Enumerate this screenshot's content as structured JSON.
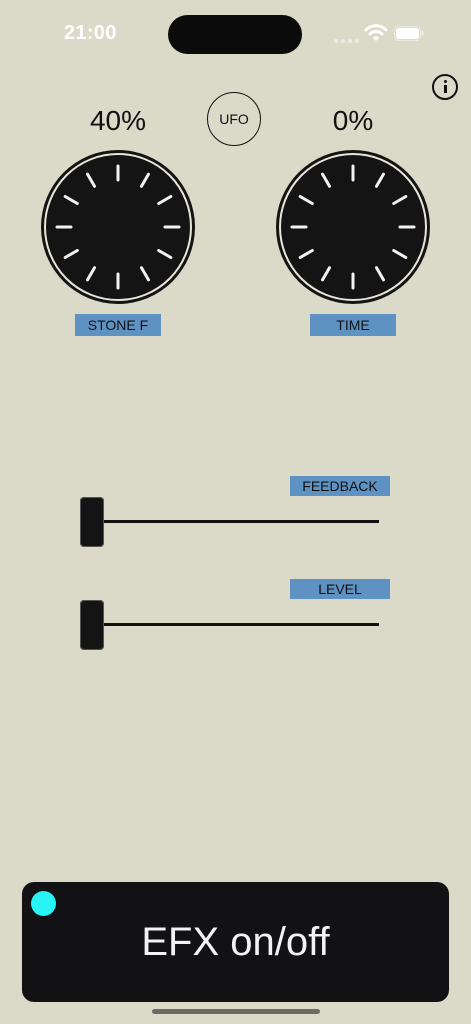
{
  "status_bar": {
    "time": "21:00"
  },
  "toolbar": {
    "info_icon": "info-icon"
  },
  "ufo_button": {
    "label": "UFO"
  },
  "knobs": [
    {
      "value_text": "40%",
      "value": 0.4,
      "label": "STONE F"
    },
    {
      "value_text": "0%",
      "value": 0.0,
      "label": "TIME"
    }
  ],
  "sliders": [
    {
      "label": "FEEDBACK",
      "value": 0.0
    },
    {
      "label": "LEVEL",
      "value": 0.0
    }
  ],
  "efx": {
    "label": "EFX on/off",
    "led_on": true,
    "led_color": "#27f4f4"
  },
  "colors": {
    "background": "#dbd9c7",
    "label_bg": "#5d92c2",
    "knob": "#141414"
  }
}
